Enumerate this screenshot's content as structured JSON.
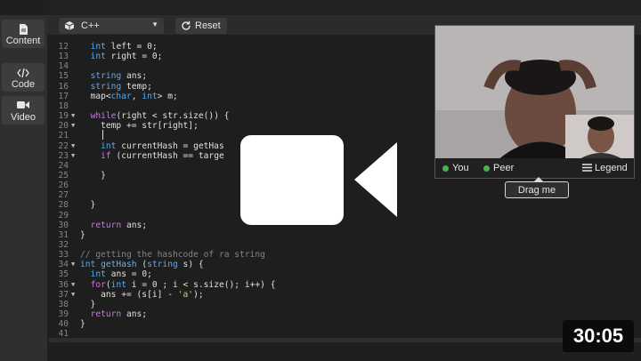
{
  "sidebar": {
    "items": [
      {
        "label": "Content",
        "icon": "document-icon"
      },
      {
        "label": "Code",
        "icon": "code-icon"
      },
      {
        "label": "Video",
        "icon": "video-camera-icon"
      }
    ]
  },
  "toolbar": {
    "language": "C++",
    "reset_label": "Reset"
  },
  "editor": {
    "lines": [
      {
        "n": "12",
        "t": "  int left = 0;"
      },
      {
        "n": "13",
        "t": "  int right = 0;"
      },
      {
        "n": "14",
        "t": ""
      },
      {
        "n": "15",
        "t": "  string ans;"
      },
      {
        "n": "16",
        "t": "  string temp;"
      },
      {
        "n": "17",
        "t": "  map<char, int> m;"
      },
      {
        "n": "18",
        "t": ""
      },
      {
        "n": "19",
        "t": "  while(right < str.size()) {",
        "fold": true
      },
      {
        "n": "20",
        "t": "    temp += str[right];",
        "fold": true
      },
      {
        "n": "21",
        "t": ""
      },
      {
        "n": "22",
        "t": "    int currentHash = getHas",
        "fold": true
      },
      {
        "n": "23",
        "t": "    if (currentHash == targe",
        "fold": true
      },
      {
        "n": "24",
        "t": ""
      },
      {
        "n": "25",
        "t": "    }"
      },
      {
        "n": "26",
        "t": ""
      },
      {
        "n": "27",
        "t": ""
      },
      {
        "n": "28",
        "t": "  }"
      },
      {
        "n": "29",
        "t": ""
      },
      {
        "n": "30",
        "t": "  return ans;"
      },
      {
        "n": "31",
        "t": "}"
      },
      {
        "n": "32",
        "t": ""
      },
      {
        "n": "33",
        "t": "// getting the hashcode of ra string"
      },
      {
        "n": "34",
        "t": "int getHash (string s) {",
        "fold": true
      },
      {
        "n": "35",
        "t": "  int ans = 0;"
      },
      {
        "n": "36",
        "t": "  for(int i = 0 ; i < s.size(); i++) {",
        "fold": true
      },
      {
        "n": "37",
        "t": "    ans += (s[i] - 'a');",
        "fold": true
      },
      {
        "n": "38",
        "t": "  }"
      },
      {
        "n": "39",
        "t": "  return ans;"
      },
      {
        "n": "40",
        "t": "}"
      },
      {
        "n": "41",
        "t": ""
      }
    ]
  },
  "video": {
    "you_label": "You",
    "peer_label": "Peer",
    "legend_label": "Legend",
    "drag_tip": "Drag me",
    "status_color": "#4caf50"
  },
  "timer": "30:05"
}
